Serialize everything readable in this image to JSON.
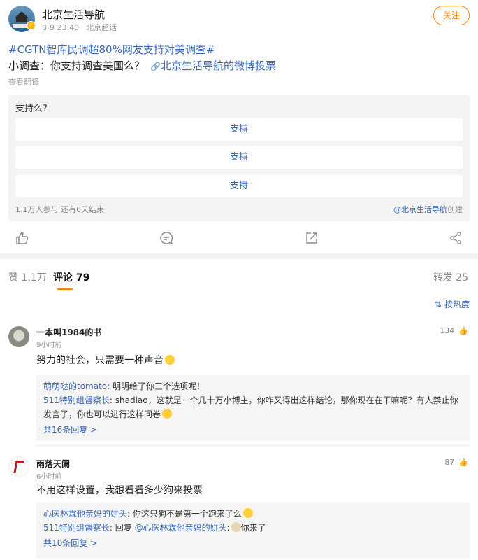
{
  "post": {
    "author": "北京生活导航",
    "time": "8-9 23:40",
    "source": "北京超话",
    "follow_label": "关注",
    "topic": "#CGTN智库民调超80%网友支持对美调查#",
    "text_prefix": "小调查：你支持调查美国么？",
    "link_text": "北京生活导航的微博投票",
    "translate": "查看翻译"
  },
  "poll": {
    "question": "支持么?",
    "options": [
      "支持",
      "支持",
      "支持"
    ],
    "stats": "1.1万人参与 还有6天结束",
    "creator": "@北京生活导航",
    "creator_suffix": "创建"
  },
  "actions": {
    "icons": [
      "like-icon",
      "comment-icon",
      "share-icon",
      "more-share-icon"
    ]
  },
  "tabs": {
    "likes": "赞 1.1万",
    "comments": "评论 79",
    "reposts": "转发 25"
  },
  "sort": {
    "label": "按热度"
  },
  "comments": [
    {
      "name": "一本叫1984的书",
      "time": "9小时前",
      "likes": "134",
      "text": "努力的社会，只需要一种声音",
      "replies": [
        {
          "user": "萌萌哒的tomato",
          "text": ": 明明给了你三个选项呢！"
        },
        {
          "user": "511特别组督察长",
          "text": ": shadiao，这就是一个几十万小博主，你咋又得出这样结论，那你现在在干嘛呢？有人禁止你发言了，你也可以进行这样问卷"
        }
      ],
      "more": "共16条回复 >"
    },
    {
      "name": "雨落天阑",
      "time": "6小时前",
      "likes": "87",
      "text": "不用这样设置，我想看看多少狗来投票",
      "replies": [
        {
          "user": "心医林霖他亲妈的姘头",
          "text": ": 你这只狗不是第一个跑来了么"
        },
        {
          "user": "511特别组督察长",
          "text": ": 回复 ",
          "mention": "@心医林霖他亲妈的姘头",
          "tail": ":",
          "tail2": "你来了"
        }
      ],
      "more": "共10条回复 >"
    }
  ],
  "colors": {
    "accent": "#ff8200",
    "link": "#3a66b3"
  }
}
